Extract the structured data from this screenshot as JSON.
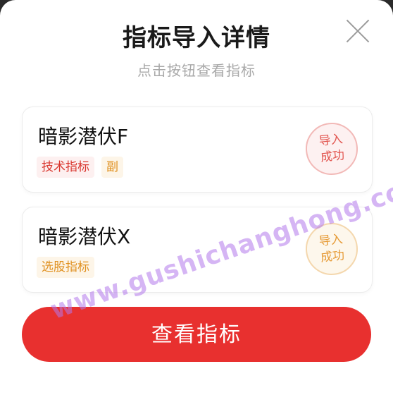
{
  "dialog": {
    "title": "指标导入详情",
    "subtitle": "点击按钮查看指标"
  },
  "items": [
    {
      "name": "暗影潜伏F",
      "tags": [
        "技术指标",
        "副"
      ],
      "status": [
        "导入",
        "成功"
      ]
    },
    {
      "name": "暗影潜伏X",
      "tags": [
        "选股指标"
      ],
      "status": [
        "导入",
        "成功"
      ]
    }
  ],
  "button": {
    "label": "查看指标"
  },
  "watermark": "www.gushichanghong.com",
  "colors": {
    "primary": "#e8302f",
    "tag_red": "#d9362e",
    "tag_orange": "#e0901f"
  }
}
